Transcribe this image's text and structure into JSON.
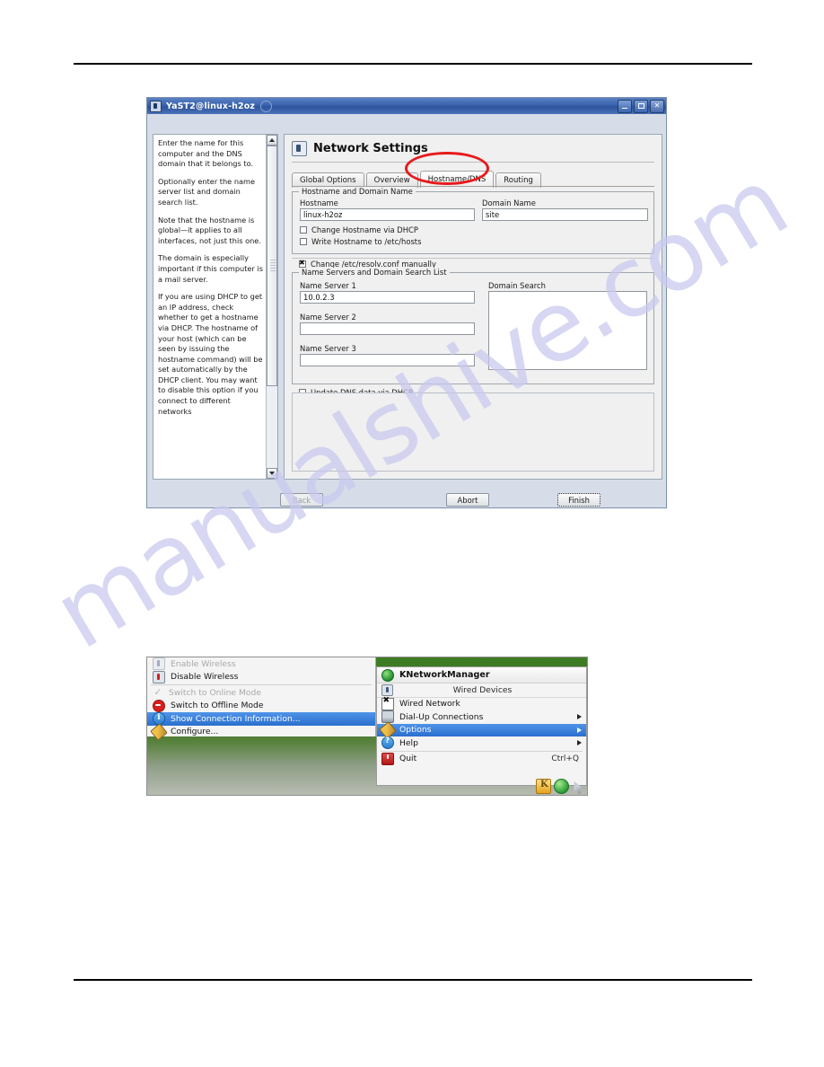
{
  "yast": {
    "titlebar": {
      "title": "YaST2@linux-h2oz",
      "minimize": "_",
      "maximize": "□",
      "close": "✕"
    },
    "help": {
      "paragraphs": [
        "Enter the name for this computer and the DNS domain that it belongs to.",
        "Optionally enter the name server list and domain search list.",
        "Note that the hostname is global—it applies to all interfaces, not just this one.",
        "The domain is especially important if this computer is a mail server.",
        "If you are using DHCP to get an IP address, check whether to get a hostname via DHCP. The hostname of your host (which can be seen by issuing the hostname command) will be set automatically by the DHCP client. You may want to disable this option if you connect to different networks"
      ]
    },
    "pane_title": "Network Settings",
    "tabs": [
      {
        "label": "Global Options",
        "active": false
      },
      {
        "label": "Overview",
        "active": false
      },
      {
        "label": "Hostname/DNS",
        "active": true
      },
      {
        "label": "Routing",
        "active": false
      }
    ],
    "hostname_group": {
      "legend": "Hostname and Domain Name",
      "hostname_label": "Hostname",
      "hostname_value": "linux-h2oz",
      "domain_label": "Domain Name",
      "domain_value": "site",
      "checkboxes": [
        {
          "label": "Change Hostname via DHCP",
          "checked": false
        },
        {
          "label": "Write Hostname to /etc/hosts",
          "checked": false
        }
      ]
    },
    "resolv_checkbox": {
      "label": "Change /etc/resolv.conf manually",
      "checked": true
    },
    "nameserver_group": {
      "legend": "Name Servers and Domain Search List",
      "ns1_label": "Name Server 1",
      "ns1_value": "10.0.2.3",
      "ns2_label": "Name Server 2",
      "ns2_value": "",
      "ns3_label": "Name Server 3",
      "ns3_value": "",
      "domain_search_label": "Domain Search",
      "domain_search_value": ""
    },
    "update_dns_checkbox": {
      "label": "Update DNS data via DHCP",
      "checked": false
    },
    "buttons": {
      "back": "Back",
      "abort": "Abort",
      "finish": "Finish"
    }
  },
  "knetworkmanager": {
    "left_menu": [
      {
        "label": "Enable Wireless",
        "state": "disabled",
        "icon": "wireless-icon"
      },
      {
        "label": "Disable Wireless",
        "state": "normal",
        "icon": "wireless-off-icon"
      },
      {
        "label": "Switch to Online Mode",
        "state": "disabled",
        "icon": "check-icon"
      },
      {
        "label": "Switch to Offline Mode",
        "state": "normal",
        "icon": "stop-icon"
      },
      {
        "label": "Show Connection Information...",
        "state": "selected",
        "icon": "info-icon"
      },
      {
        "label": "Configure...",
        "state": "normal",
        "icon": "wrench-icon"
      }
    ],
    "header": "KNetworkManager",
    "subheader": "Wired Devices",
    "right_menu": [
      {
        "label": "Wired Network",
        "icon": "x-icon",
        "state": "normal",
        "submenu": false,
        "shortcut": ""
      },
      {
        "label": "Dial-Up Connections",
        "icon": "modem-icon",
        "state": "normal",
        "submenu": true,
        "shortcut": ""
      },
      {
        "label": "Options",
        "icon": "wrench-icon",
        "state": "selected",
        "submenu": true,
        "shortcut": ""
      },
      {
        "label": "Help",
        "icon": "help-icon",
        "state": "normal",
        "submenu": true,
        "shortcut": ""
      },
      {
        "label": "Quit",
        "icon": "quit-icon",
        "state": "normal",
        "submenu": false,
        "shortcut": "Ctrl+Q"
      }
    ],
    "tray": [
      {
        "name": "kde-menu-icon"
      },
      {
        "name": "knetworkmanager-tray-icon"
      },
      {
        "name": "cursor-icon"
      }
    ]
  },
  "watermark": {
    "text": "manualshive.com"
  }
}
